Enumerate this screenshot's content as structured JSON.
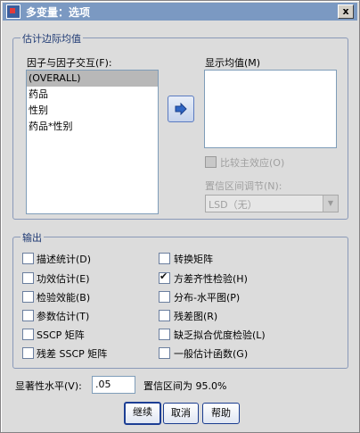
{
  "window": {
    "title": "多变量：选项",
    "close_glyph": "x"
  },
  "estimate_group": {
    "title": "估计边际均值",
    "factors_label": "因子与因子交互(F):",
    "factors": [
      "(OVERALL)",
      "药品",
      "性别",
      "药品*性别"
    ],
    "selected_index": 0,
    "display_means_label": "显示均值(M)",
    "compare_main_effects": {
      "label": "比较主效应(O)",
      "checked": false,
      "enabled": false
    },
    "ci_adjust_label": "置信区间调节(N):",
    "ci_adjust_value": "LSD（无）"
  },
  "output_group": {
    "title": "输出",
    "options_left": [
      {
        "label": "描述统计(D)",
        "checked": false
      },
      {
        "label": "功效估计(E)",
        "checked": false
      },
      {
        "label": "检验效能(B)",
        "checked": false
      },
      {
        "label": "参数估计(T)",
        "checked": false
      },
      {
        "label": "SSCP 矩阵",
        "checked": false
      },
      {
        "label": "残差 SSCP 矩阵",
        "checked": false
      }
    ],
    "options_right": [
      {
        "label": "转换矩阵",
        "checked": false
      },
      {
        "label": "方差齐性检验(H)",
        "checked": true
      },
      {
        "label": "分布-水平图(P)",
        "checked": false
      },
      {
        "label": "残差图(R)",
        "checked": false
      },
      {
        "label": "缺乏拟合优度检验(L)",
        "checked": false
      },
      {
        "label": "一般估计函数(G)",
        "checked": false
      }
    ]
  },
  "significance": {
    "label": "显著性水平(V):",
    "value": ".05",
    "ci_text": "置信区间为 95.0%"
  },
  "buttons": {
    "continue": "继续",
    "cancel": "取消",
    "help": "帮助"
  }
}
